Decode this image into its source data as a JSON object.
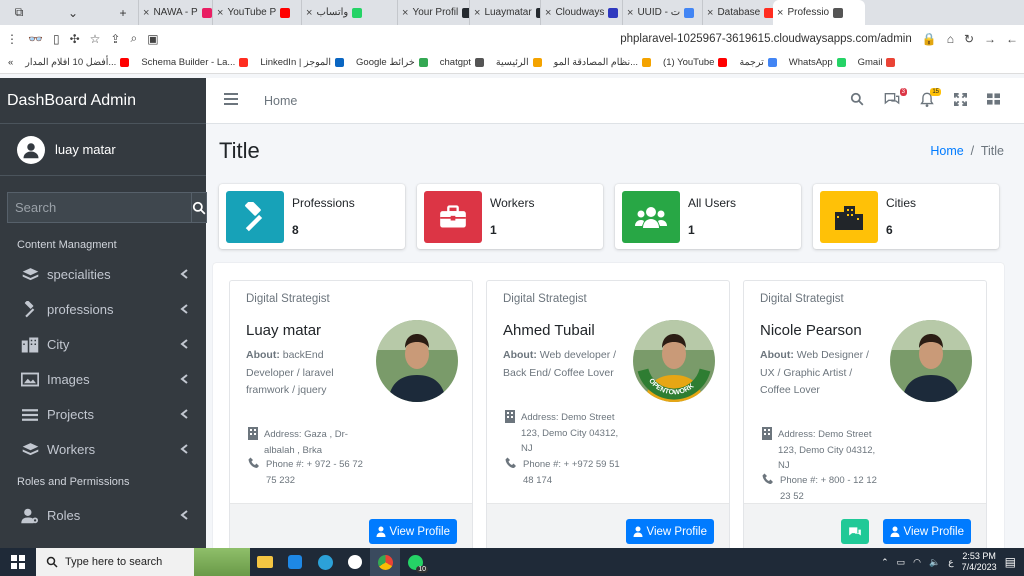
{
  "browser": {
    "tabs": [
      {
        "label": "NAWA - P",
        "color": "#e91e63"
      },
      {
        "label": "YouTube P",
        "color": "#ff0000"
      },
      {
        "label": "واتساب",
        "color": "#25d366"
      },
      {
        "label": "Your Profil",
        "color": "#24292e"
      },
      {
        "label": "Luaymatar",
        "color": "#24292e"
      },
      {
        "label": "Cloudways",
        "color": "#2f39bf"
      },
      {
        "label": "UUID - ت",
        "color": "#4285f4"
      },
      {
        "label": "Database",
        "color": "#ff2d20"
      },
      {
        "label": "Professio",
        "color": "#555555"
      }
    ],
    "url": "phplaravel-1025967-3619615.cloudwaysapps.com/admin",
    "bookmarks": [
      {
        "label": "أفضل 10 افلام المدار...",
        "color": "#ff0000"
      },
      {
        "label": "Schema Builder - La...",
        "color": "#ff2d20"
      },
      {
        "label": "LinkedIn | الموجز",
        "color": "#0a66c2"
      },
      {
        "label": "Google خرائط",
        "color": "#34a853"
      },
      {
        "label": "chatgpt",
        "color": "#555555"
      },
      {
        "label": "الرئيسية",
        "color": "#f4a300"
      },
      {
        "label": "نظام المصادقة المو...",
        "color": "#f4a300"
      },
      {
        "label": "(1) YouTube",
        "color": "#ff0000"
      },
      {
        "label": "ترجمة",
        "color": "#4285f4"
      },
      {
        "label": "WhatsApp",
        "color": "#25d366"
      },
      {
        "label": "Gmail",
        "color": "#ea4335"
      }
    ]
  },
  "sidebar": {
    "brand": "DashBoard Admin",
    "user_name": "luay matar",
    "search_placeholder": "Search",
    "section_content": "Content Managment",
    "items": [
      {
        "label": "specialities",
        "icon": "layers-icon"
      },
      {
        "label": "professions",
        "icon": "hammer-icon"
      },
      {
        "label": "City",
        "icon": "building-icon"
      },
      {
        "label": "Images",
        "icon": "image-icon"
      },
      {
        "label": "Projects",
        "icon": "list-icon"
      },
      {
        "label": "Workers",
        "icon": "layers-icon"
      }
    ],
    "section_roles": "Roles and Permissions",
    "roles_label": "Roles"
  },
  "topnav": {
    "home_label": "Home",
    "messages_count": "3",
    "notifications_count": "15"
  },
  "page": {
    "title": "Title",
    "breadcrumb_home": "Home",
    "breadcrumb_current": "Title"
  },
  "stats": [
    {
      "label": "Professions",
      "value": "8",
      "color": "#17a2b8",
      "icon": "hammer-icon"
    },
    {
      "label": "Workers",
      "value": "1",
      "color": "#dc3545",
      "icon": "briefcase-icon"
    },
    {
      "label": "All Users",
      "value": "1",
      "color": "#28a745",
      "icon": "users-icon"
    },
    {
      "label": "Cities",
      "value": "6",
      "color": "#ffc107",
      "icon": "city-icon"
    }
  ],
  "workers": [
    {
      "role": "Digital Strategist",
      "name": "Luay matar",
      "about_label": "About:",
      "about": "backEnd Developer / laravel framwork / jquery",
      "address": "Address: Gaza , Dr-albalah , Brka",
      "phone": "Phone #: + 972 - 56 72 75 232",
      "button": "View Profile"
    },
    {
      "role": "Digital Strategist",
      "name": "Ahmed Tubail",
      "about_label": "About:",
      "about": "Web developer / Back End/ Coffee Lover",
      "address": "Address: Demo Street 123, Demo City 04312, NJ",
      "phone": "Phone #: + +972 59 51 48 174",
      "badge_text": "OPENTOWORK",
      "button": "View Profile"
    },
    {
      "role": "Digital Strategist",
      "name": "Nicole Pearson",
      "about_label": "About:",
      "about": "Web Designer / UX / Graphic Artist / Coffee Lover",
      "address": "Address: Demo Street 123, Demo City 04312, NJ",
      "phone": "Phone #: + 800 - 12 12 23 52",
      "button": "View Profile"
    }
  ],
  "taskbar": {
    "search_placeholder": "Type here to search",
    "time": "2:53 PM",
    "date": "7/4/2023",
    "lang": "ع",
    "whatsapp_count": "10"
  }
}
